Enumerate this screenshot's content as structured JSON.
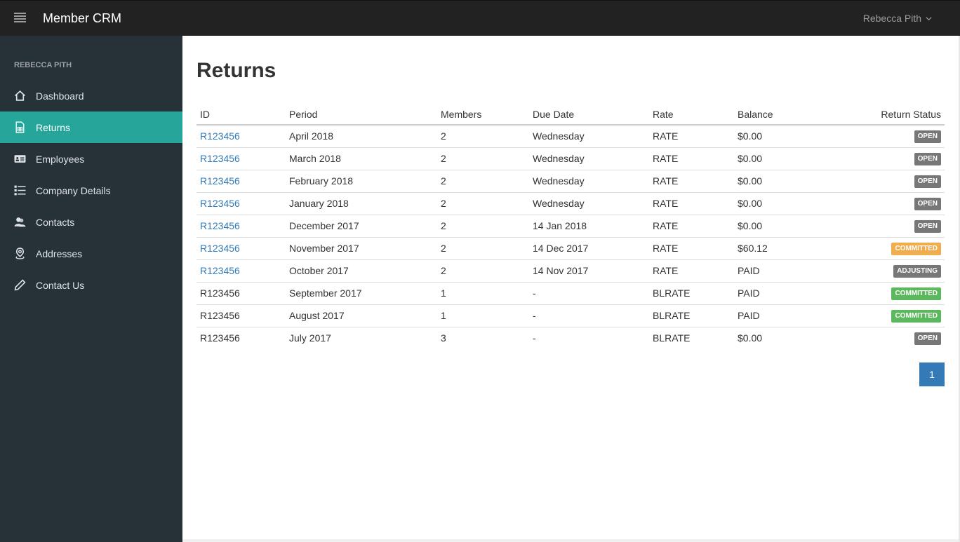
{
  "header": {
    "brand": "Member CRM",
    "user_name": "Rebecca Pith",
    "menu_icon": "hamburger-icon",
    "dropdown_icon": "chevron-down-icon"
  },
  "sidebar": {
    "heading": "REBECCA PITH",
    "active_color": "#26a69a",
    "items": [
      {
        "label": "Dashboard",
        "icon": "home-icon",
        "active": false
      },
      {
        "label": "Returns",
        "icon": "spreadsheet-file-icon",
        "active": true
      },
      {
        "label": "Employees",
        "icon": "id-card-icon",
        "active": false
      },
      {
        "label": "Company Details",
        "icon": "list-icon",
        "active": false
      },
      {
        "label": "Contacts",
        "icon": "users-icon",
        "active": false
      },
      {
        "label": "Addresses",
        "icon": "map-marker-icon",
        "active": false
      },
      {
        "label": "Contact Us",
        "icon": "pencil-icon",
        "active": false
      }
    ]
  },
  "main": {
    "title": "Returns",
    "table": {
      "columns": [
        "ID",
        "Period",
        "Members",
        "Due Date",
        "Rate",
        "Balance",
        "Return Status"
      ],
      "rows": [
        {
          "id": "R123456",
          "link": true,
          "period": "April 2018",
          "members": "2",
          "due": "Wednesday",
          "rate": "RATE",
          "balance": "$0.00",
          "status": "OPEN",
          "status_type": "open"
        },
        {
          "id": "R123456",
          "link": true,
          "period": "March 2018",
          "members": "2",
          "due": "Wednesday",
          "rate": "RATE",
          "balance": "$0.00",
          "status": "OPEN",
          "status_type": "open"
        },
        {
          "id": "R123456",
          "link": true,
          "period": "February 2018",
          "members": "2",
          "due": "Wednesday",
          "rate": "RATE",
          "balance": "$0.00",
          "status": "OPEN",
          "status_type": "open"
        },
        {
          "id": "R123456",
          "link": true,
          "period": "January 2018",
          "members": "2",
          "due": "Wednesday",
          "rate": "RATE",
          "balance": "$0.00",
          "status": "OPEN",
          "status_type": "open"
        },
        {
          "id": "R123456",
          "link": true,
          "period": "December 2017",
          "members": "2",
          "due": "14 Jan 2018",
          "rate": "RATE",
          "balance": "$0.00",
          "status": "OPEN",
          "status_type": "open"
        },
        {
          "id": "R123456",
          "link": true,
          "period": "November 2017",
          "members": "2",
          "due": "14 Dec 2017",
          "rate": "RATE",
          "balance": "$60.12",
          "status": "COMMITTED",
          "status_type": "committed-warn"
        },
        {
          "id": "R123456",
          "link": true,
          "period": "October 2017",
          "members": "2",
          "due": "14 Nov 2017",
          "rate": "RATE",
          "balance": "PAID",
          "status": "ADJUSTING",
          "status_type": "adjusting"
        },
        {
          "id": "R123456",
          "link": false,
          "period": "September 2017",
          "members": "1",
          "due": "-",
          "rate": "BLRATE",
          "balance": "PAID",
          "status": "COMMITTED",
          "status_type": "committed-ok"
        },
        {
          "id": "R123456",
          "link": false,
          "period": "August 2017",
          "members": "1",
          "due": "-",
          "rate": "BLRATE",
          "balance": "PAID",
          "status": "COMMITTED",
          "status_type": "committed-ok"
        },
        {
          "id": "R123456",
          "link": false,
          "period": "July 2017",
          "members": "3",
          "due": "-",
          "rate": "BLRATE",
          "balance": "$0.00",
          "status": "OPEN",
          "status_type": "open"
        }
      ]
    },
    "pagination": {
      "current_page": "1"
    }
  },
  "colors": {
    "topbar": "#222222",
    "sidebar": "#263238",
    "link": "#337ab7",
    "badge_open": "#777777",
    "badge_warning": "#f0ad4e",
    "badge_success": "#5cb85c"
  }
}
